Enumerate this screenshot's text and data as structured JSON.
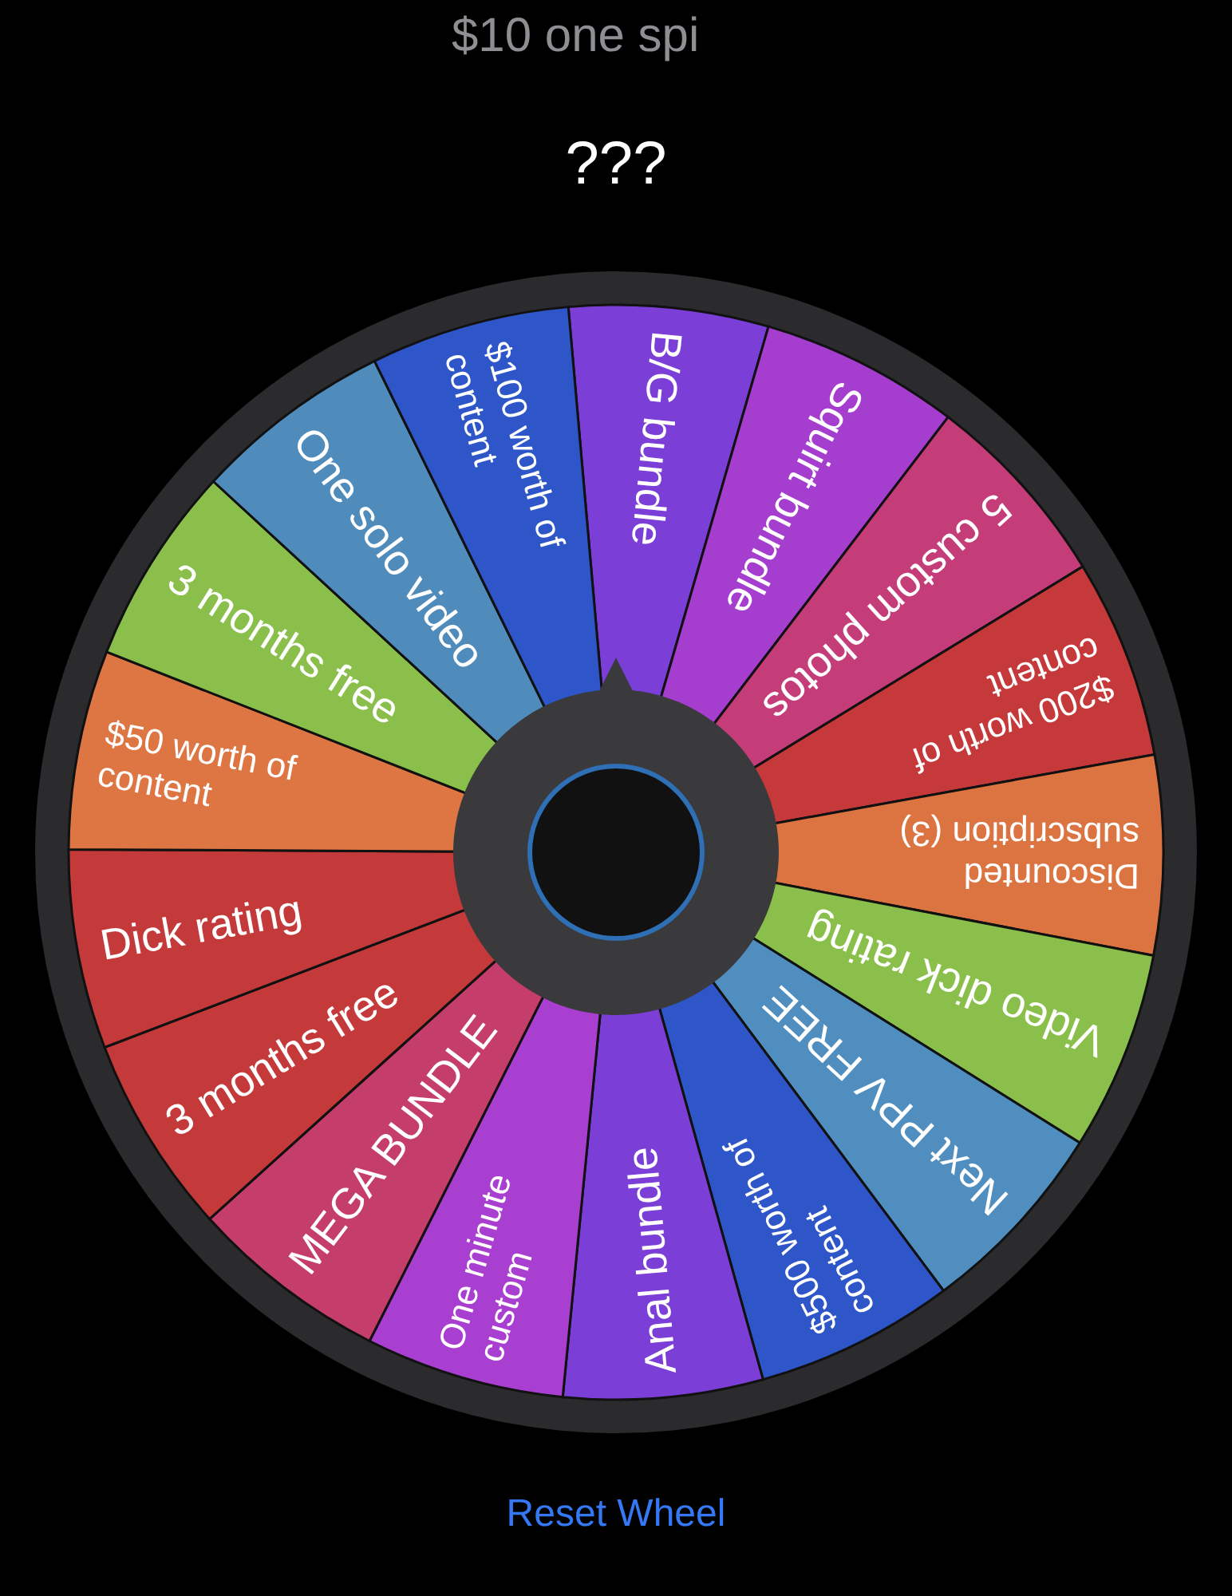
{
  "header": {
    "title": "$10 one spi",
    "prompt": "???"
  },
  "wheel": {
    "segments": [
      {
        "lines": [
          "B/G bundle"
        ],
        "color": "#7b3fd8"
      },
      {
        "lines": [
          "Squirt bundle"
        ],
        "color": "#a53dcf"
      },
      {
        "lines": [
          "5 custom photos"
        ],
        "color": "#c43d79"
      },
      {
        "lines": [
          "$200 worth of",
          "content"
        ],
        "color": "#c6393b"
      },
      {
        "lines": [
          "Discounted",
          "subscription (3)"
        ],
        "color": "#dc7442"
      },
      {
        "lines": [
          "Video dick rating"
        ],
        "color": "#8bbf4b"
      },
      {
        "lines": [
          "Next PPV FREE"
        ],
        "color": "#4f8ebe"
      },
      {
        "lines": [
          "$500 worth of",
          "content"
        ],
        "color": "#2f56c9"
      },
      {
        "lines": [
          "Anal bundle"
        ],
        "color": "#7b3fd8"
      },
      {
        "lines": [
          "One minute",
          "custom"
        ],
        "color": "#a93fd0"
      },
      {
        "lines": [
          "MEGA BUNDLE"
        ],
        "color": "#c43d6b"
      },
      {
        "lines": [
          "3 months free"
        ],
        "color": "#c43a3a"
      },
      {
        "lines": [
          "Dick rating"
        ],
        "color": "#c43a3a"
      },
      {
        "lines": [
          "$50 worth of",
          "content"
        ],
        "color": "#dd7643"
      },
      {
        "lines": [
          "3 months free"
        ],
        "color": "#8bbf4b"
      },
      {
        "lines": [
          "One solo video"
        ],
        "color": "#4f8cbc"
      },
      {
        "lines": [
          "$100 worth of",
          "content"
        ],
        "color": "#2f56c9"
      }
    ]
  },
  "reset_button": "Reset Wheel"
}
